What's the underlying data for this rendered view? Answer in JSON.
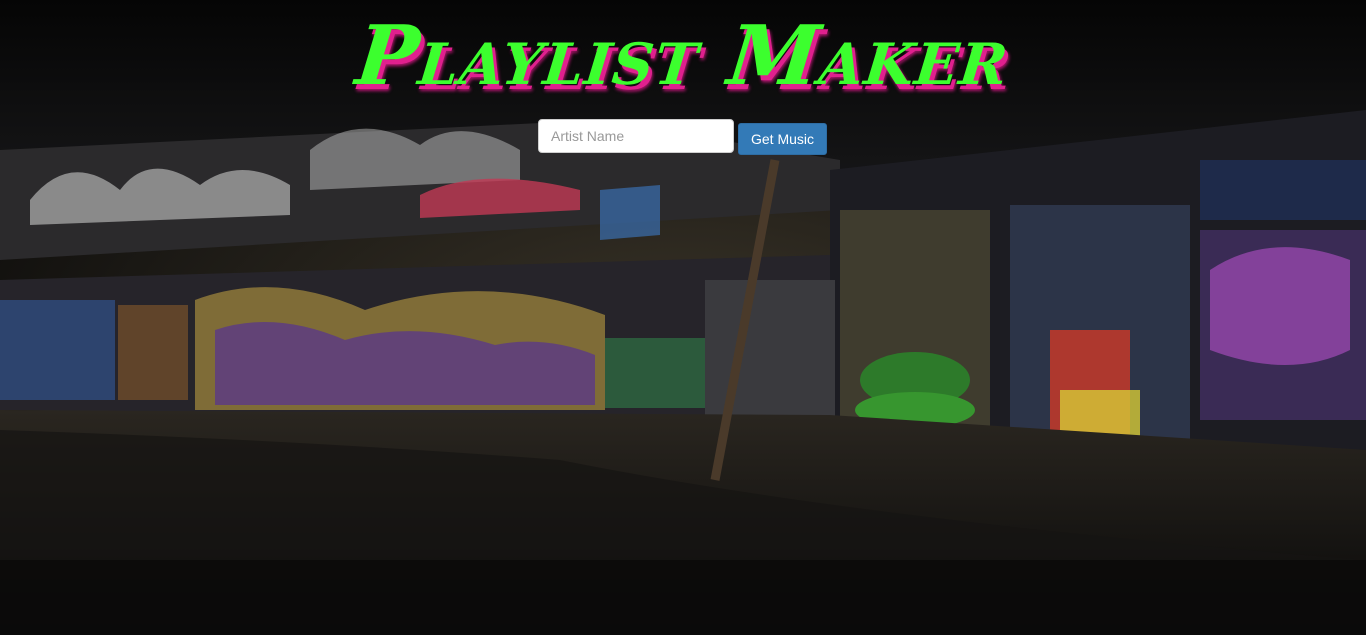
{
  "header": {
    "title": "Playlist Maker"
  },
  "search": {
    "placeholder": "Artist Name",
    "value": "",
    "button_label": "Get Music"
  },
  "colors": {
    "title": "#3cff2e",
    "title_shadow": "#e0208e",
    "button": "#337ab7"
  }
}
